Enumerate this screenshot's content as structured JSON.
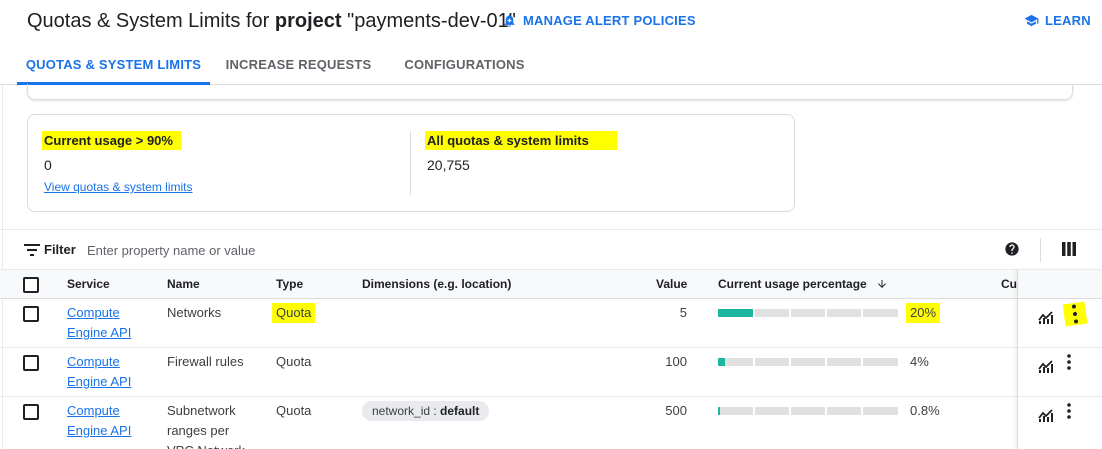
{
  "header": {
    "title_prefix": "Quotas & System Limits for",
    "title_bold": "project",
    "title_project": "\"payments-dev-01\"",
    "manage_alert_label": "MANAGE ALERT POLICIES",
    "learn_label": "LEARN"
  },
  "tabs": [
    {
      "label": "QUOTAS & SYSTEM LIMITS",
      "active": true
    },
    {
      "label": "INCREASE REQUESTS",
      "active": false
    },
    {
      "label": "CONFIGURATIONS",
      "active": false
    }
  ],
  "summary": {
    "current_usage_label": "Current usage > 90%",
    "current_usage_value": "0",
    "view_link": "View quotas & system limits",
    "all_label": "All quotas & system limits",
    "all_value": "20,755"
  },
  "filter": {
    "label": "Filter",
    "placeholder": "Enter property name or value"
  },
  "table": {
    "headers": {
      "service": "Service",
      "name": "Name",
      "type": "Type",
      "dimensions": "Dimensions (e.g. location)",
      "value": "Value",
      "usage": "Current usage percentage",
      "cut": "Cu"
    },
    "rows": [
      {
        "service_line1": "Compute",
        "service_line2": "Engine API",
        "name": "Networks",
        "type": "Quota",
        "dimension_key": "",
        "dimension_value": "",
        "value": "5",
        "usage_pct": "20%",
        "usage_fraction": 0.2
      },
      {
        "service_line1": "Compute",
        "service_line2": "Engine API",
        "name": "Firewall rules",
        "type": "Quota",
        "dimension_key": "",
        "dimension_value": "",
        "value": "100",
        "usage_pct": "4%",
        "usage_fraction": 0.04
      },
      {
        "service_line1": "Compute",
        "service_line2": "Engine API",
        "name": "Subnetwork ranges per VPC Network",
        "name_line1": "Subnetwork",
        "name_line2": "ranges per",
        "name_line3": "VPC Network",
        "type": "Quota",
        "dimension_key": "network_id",
        "dimension_value": "default",
        "value": "500",
        "usage_pct": "0.8%",
        "usage_fraction": 0.008
      }
    ]
  },
  "colors": {
    "accent": "#1a73e8",
    "usage_fill": "#1bb5a0",
    "highlight": "#ffff00"
  },
  "icons": [
    "alert-bell-icon",
    "learn-cap-icon",
    "filter-icon",
    "help-icon",
    "column-display-icon",
    "monitoring-chart-icon",
    "more-vert-icon",
    "arrow-down-icon"
  ]
}
